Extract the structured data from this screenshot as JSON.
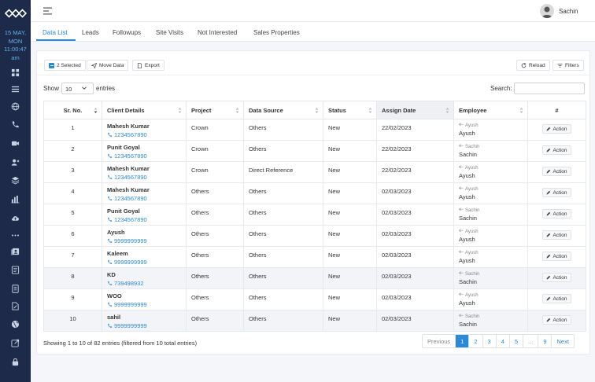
{
  "sidebar": {
    "date_line1": "15 MAY,",
    "date_line2": "MON",
    "time_line1": "11:00:47",
    "time_line2": "am",
    "icons": [
      "dashboard-icon",
      "list-icon",
      "globe-icon",
      "phone-icon",
      "video-icon",
      "user-x-icon",
      "layers-icon",
      "bar-chart-icon",
      "cloud-upload-icon",
      "more-icon",
      "contact-card-icon",
      "document-icon",
      "report-icon",
      "file-edit-icon",
      "globe-alt-icon",
      "export-box-icon",
      "lock-icon"
    ]
  },
  "header": {
    "username": "Sachin"
  },
  "tabs": [
    "Data List",
    "Leads",
    "Followups",
    "Site Visits",
    "Not Interested",
    "Sales Properties"
  ],
  "toolbar": {
    "selected_label": "2 Selected",
    "move_label": "Move Data",
    "export_label": "Export",
    "reload_label": "Reload",
    "filters_label": "Filters"
  },
  "table_controls": {
    "show_label": "Show",
    "show_value": "10",
    "entries_label": "entries",
    "search_label": "Search:"
  },
  "columns": [
    "Sr. No.",
    "Client Details",
    "Project",
    "Data Source",
    "Status",
    "Assign Date",
    "Employee",
    "#"
  ],
  "rows": [
    {
      "sr": "1",
      "name": "Mahesh Kumar",
      "phone": "1234567890",
      "project": "Crown",
      "source": "Others",
      "status": "New",
      "date": "22/02/2023",
      "emp_old": "Ayush",
      "emp_new": "Ayush",
      "action": "Action"
    },
    {
      "sr": "2",
      "name": "Punit Goyal",
      "phone": "1234567890",
      "project": "Crown",
      "source": "Others",
      "status": "New",
      "date": "22/02/2023",
      "emp_old": "Sachin",
      "emp_new": "Sachin",
      "action": "Action"
    },
    {
      "sr": "3",
      "name": "Mahesh Kumar",
      "phone": "1234567890",
      "project": "Crown",
      "source": "Direct Reference",
      "status": "New",
      "date": "22/02/2023",
      "emp_old": "Ayush",
      "emp_new": "Ayush",
      "action": "Action"
    },
    {
      "sr": "4",
      "name": "Mahesh Kumar",
      "phone": "1234567890",
      "project": "Others",
      "source": "Others",
      "status": "New",
      "date": "02/03/2023",
      "emp_old": "Ayush",
      "emp_new": "Ayush",
      "action": "Action"
    },
    {
      "sr": "5",
      "name": "Punit Goyal",
      "phone": "1234567890",
      "project": "Others",
      "source": "Others",
      "status": "New",
      "date": "02/03/2023",
      "emp_old": "Sachin",
      "emp_new": "Sachin",
      "action": "Action"
    },
    {
      "sr": "6",
      "name": "Ayush",
      "phone": "9999999999",
      "project": "Others",
      "source": "Others",
      "status": "New",
      "date": "02/03/2023",
      "emp_old": "Ayush",
      "emp_new": "Ayush",
      "action": "Action"
    },
    {
      "sr": "7",
      "name": "Kaleem",
      "phone": "9999999999",
      "project": "Others",
      "source": "Others",
      "status": "New",
      "date": "02/03/2023",
      "emp_old": "Ayush",
      "emp_new": "Ayush",
      "action": "Action"
    },
    {
      "sr": "8",
      "name": "KD",
      "phone": "739498932",
      "project": "Others",
      "source": "Others",
      "status": "New",
      "date": "02/03/2023",
      "emp_old": "Sachin",
      "emp_new": "Sachin",
      "action": "Action"
    },
    {
      "sr": "9",
      "name": "WOO",
      "phone": "9999999999",
      "project": "Others",
      "source": "Others",
      "status": "New",
      "date": "02/03/2023",
      "emp_old": "Ayush",
      "emp_new": "Ayush",
      "action": "Action"
    },
    {
      "sr": "10",
      "name": "sahil",
      "phone": "9999999999",
      "project": "Others",
      "source": "Others",
      "status": "New",
      "date": "02/03/2023",
      "emp_old": "Sachin",
      "emp_new": "Sachin",
      "action": "Action"
    }
  ],
  "footer": {
    "info": "Showing 1 to 10 of 82 entries (filtered from 10 total entries)",
    "pagination": [
      "Previous",
      "1",
      "2",
      "3",
      "4",
      "5",
      "...",
      "9",
      "Next"
    ]
  },
  "colors": {
    "accent": "#2a8ad8",
    "sidebar": "#1d2a4a",
    "date_text": "#5fb3f0"
  }
}
